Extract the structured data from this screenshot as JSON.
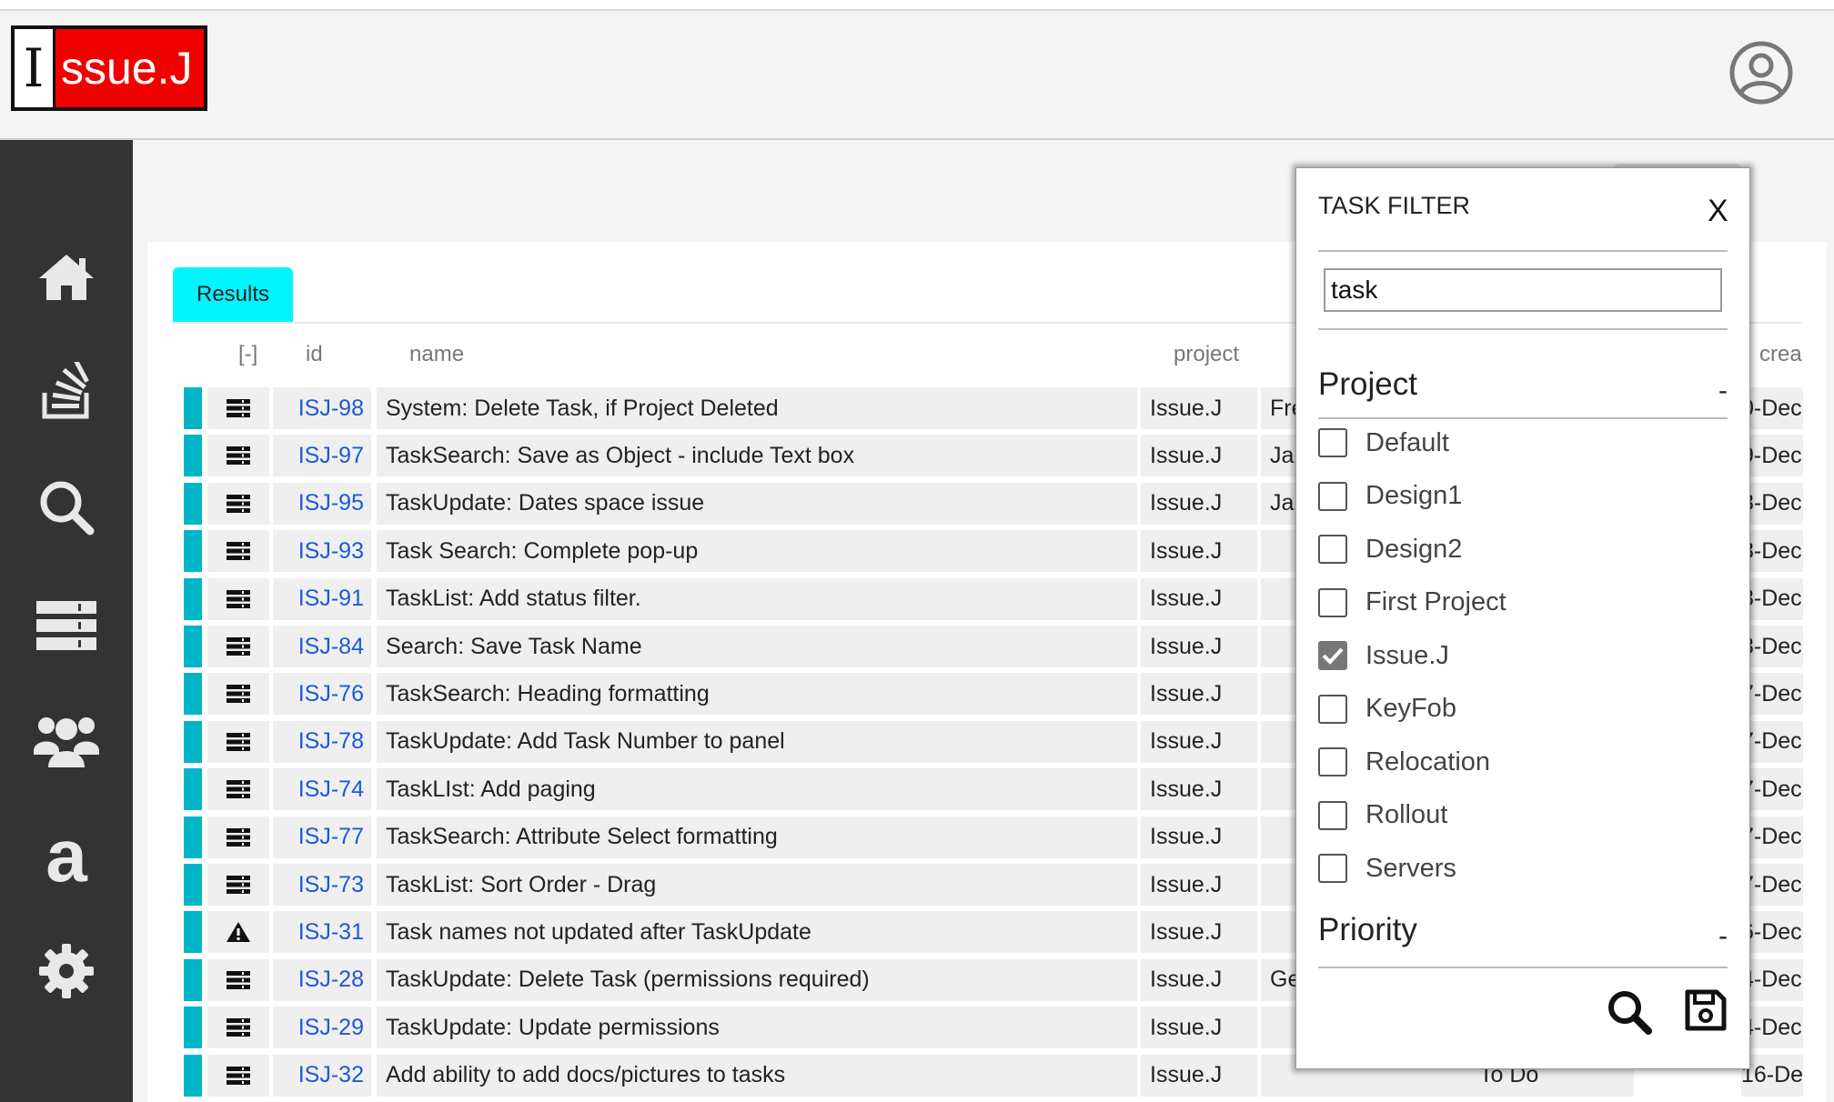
{
  "app": {
    "logo_initial": "I",
    "logo_rest": "ssue.J"
  },
  "sidebar": {
    "items": [
      {
        "icon": "home-icon"
      },
      {
        "icon": "stack-icon"
      },
      {
        "icon": "search-icon"
      },
      {
        "icon": "task-list-icon"
      },
      {
        "icon": "users-icon"
      },
      {
        "icon": "attributes-icon",
        "glyph": "a"
      },
      {
        "icon": "gear-icon"
      }
    ]
  },
  "results": {
    "tab_label": "Results",
    "columns": {
      "toggle": "[-]",
      "id": "id",
      "name": "name",
      "project": "project",
      "created": "crea"
    },
    "rows": [
      {
        "id": "ISJ-98",
        "name": "System: Delete Task, if Project Deleted",
        "project": "Issue.J",
        "assignee": "Fre",
        "status": "",
        "created": "0-Dec",
        "type": "task"
      },
      {
        "id": "ISJ-97",
        "name": "TaskSearch: Save as Object - include Text box",
        "project": "Issue.J",
        "assignee": "Ja",
        "status": "",
        "created": "9-Dec",
        "type": "task"
      },
      {
        "id": "ISJ-95",
        "name": "TaskUpdate: Dates space issue",
        "project": "Issue.J",
        "assignee": "Ja",
        "status": "",
        "created": "8-Dec",
        "type": "task"
      },
      {
        "id": "ISJ-93",
        "name": "Task Search: Complete pop-up",
        "project": "Issue.J",
        "assignee": "",
        "status": "",
        "created": "8-Dec",
        "type": "task"
      },
      {
        "id": "ISJ-91",
        "name": "TaskList: Add status filter.",
        "project": "Issue.J",
        "assignee": "",
        "status": "",
        "created": "8-Dec",
        "type": "task"
      },
      {
        "id": "ISJ-84",
        "name": "Search: Save Task Name",
        "project": "Issue.J",
        "assignee": "",
        "status": "",
        "created": "8-Dec",
        "type": "task"
      },
      {
        "id": "ISJ-76",
        "name": "TaskSearch: Heading formatting",
        "project": "Issue.J",
        "assignee": "",
        "status": "",
        "created": "7-Dec",
        "type": "task"
      },
      {
        "id": "ISJ-78",
        "name": "TaskUpdate: Add Task Number to panel",
        "project": "Issue.J",
        "assignee": "",
        "status": "",
        "created": "7-Dec",
        "type": "task"
      },
      {
        "id": "ISJ-74",
        "name": "TaskLIst: Add paging",
        "project": "Issue.J",
        "assignee": "",
        "status": "",
        "created": "7-Dec",
        "type": "task"
      },
      {
        "id": "ISJ-77",
        "name": "TaskSearch: Attribute Select formatting",
        "project": "Issue.J",
        "assignee": "",
        "status": "",
        "created": "7-Dec",
        "type": "task"
      },
      {
        "id": "ISJ-73",
        "name": "TaskList: Sort Order - Drag",
        "project": "Issue.J",
        "assignee": "",
        "status": "",
        "created": "7-Dec",
        "type": "task"
      },
      {
        "id": "ISJ-31",
        "name": "Task names not updated after TaskUpdate",
        "project": "Issue.J",
        "assignee": "",
        "status": "",
        "created": "6-Dec",
        "type": "bug"
      },
      {
        "id": "ISJ-28",
        "name": "TaskUpdate: Delete Task (permissions required)",
        "project": "Issue.J",
        "assignee": "Ge",
        "status": "",
        "created": "4-Dec",
        "type": "task"
      },
      {
        "id": "ISJ-29",
        "name": "TaskUpdate: Update permissions",
        "project": "Issue.J",
        "assignee": "",
        "status": "",
        "created": "4-Dec",
        "type": "task"
      },
      {
        "id": "ISJ-32",
        "name": "Add ability to add docs/pictures to tasks",
        "project": "Issue.J",
        "assignee": "",
        "status": "To Do",
        "created": "16-Dec",
        "type": "task"
      }
    ]
  },
  "filter": {
    "title": "TASK FILTER",
    "close_label": "X",
    "search_value": "task",
    "project_heading": "Project",
    "project_collapse": "-",
    "projects": [
      {
        "label": "Default",
        "checked": false
      },
      {
        "label": "Design1",
        "checked": false
      },
      {
        "label": "Design2",
        "checked": false
      },
      {
        "label": "First Project",
        "checked": false
      },
      {
        "label": "Issue.J",
        "checked": true
      },
      {
        "label": "KeyFob",
        "checked": false
      },
      {
        "label": "Relocation",
        "checked": false
      },
      {
        "label": "Rollout",
        "checked": false
      },
      {
        "label": "Servers",
        "checked": false
      }
    ],
    "priority_heading": "Priority",
    "priority_collapse": "-"
  },
  "colors": {
    "accent_cyan": "#00f5ff",
    "row_marker": "#00b5c8",
    "link_blue": "#1a5ad8",
    "logo_red": "#f00000",
    "sidebar_bg": "#333333"
  }
}
